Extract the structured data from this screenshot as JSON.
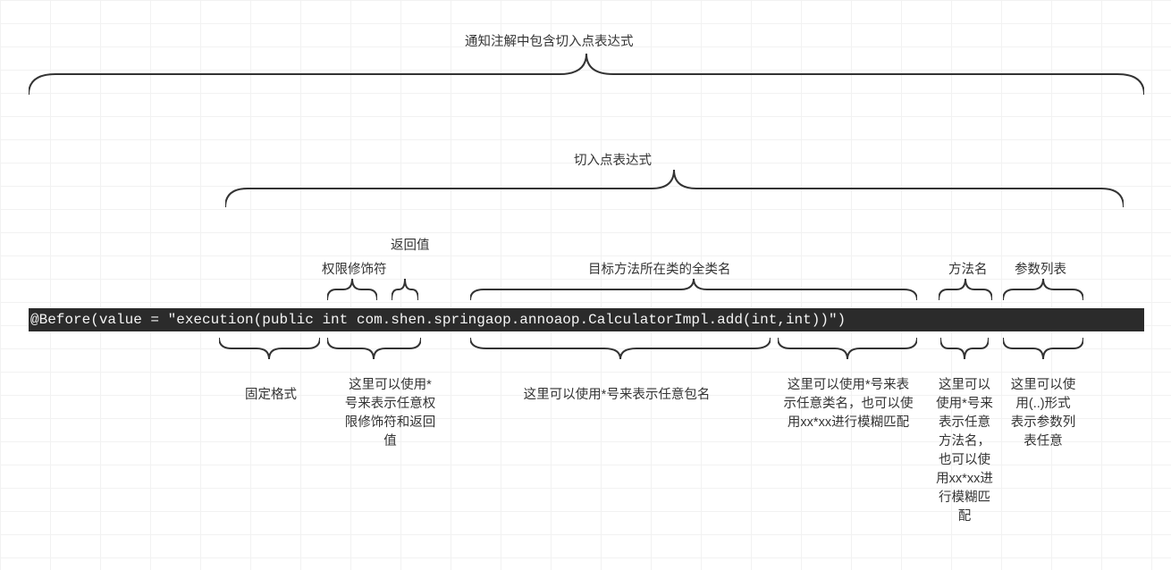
{
  "title_top": "通知注解中包含切入点表达式",
  "title_expr": "切入点表达式",
  "labels_above": {
    "return": "返回值",
    "modifier": "权限修饰符",
    "fqcn": "目标方法所在类的全类名",
    "method": "方法名",
    "params": "参数列表"
  },
  "code": "@Before(value = \"execution(public int com.shen.springaop.annoaop.CalculatorImpl.add(int,int))\")",
  "labels_below": {
    "fixed": "固定格式",
    "mod_ret": "这里可以使用*号来表示任意权限修饰符和返回值",
    "pkg": "这里可以使用*号来表示任意包名",
    "cls": "这里可以使用*号来表示任意类名，也可以使用xx*xx进行模糊匹配",
    "meth": "这里可以使用*号来表示任意方法名，也可以使用xx*xx进行模糊匹配",
    "args": "这里可以使用(..)形式表示参数列表任意"
  }
}
